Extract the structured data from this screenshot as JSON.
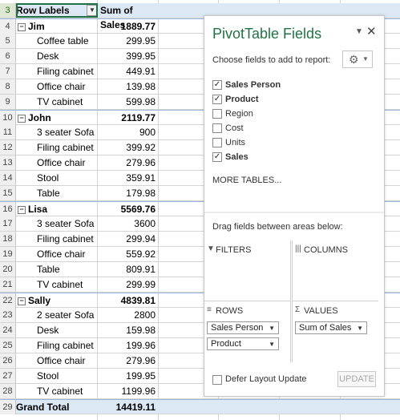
{
  "pivot": {
    "header_row_num": "3",
    "col_a_header": "Row Labels",
    "col_b_header": "Sum of Sales",
    "rows": [
      {
        "num": "4",
        "label": "Jim",
        "value": "1889.77",
        "kind": "group"
      },
      {
        "num": "5",
        "label": "Coffee table",
        "value": "299.95",
        "kind": "item"
      },
      {
        "num": "6",
        "label": "Desk",
        "value": "399.95",
        "kind": "item"
      },
      {
        "num": "7",
        "label": "Filing cabinet",
        "value": "449.91",
        "kind": "item"
      },
      {
        "num": "8",
        "label": "Office chair",
        "value": "139.98",
        "kind": "item"
      },
      {
        "num": "9",
        "label": "TV cabinet",
        "value": "599.98",
        "kind": "item"
      },
      {
        "num": "10",
        "label": "John",
        "value": "2119.77",
        "kind": "group"
      },
      {
        "num": "11",
        "label": "3 seater Sofa",
        "value": "900",
        "kind": "item"
      },
      {
        "num": "12",
        "label": "Filing cabinet",
        "value": "399.92",
        "kind": "item"
      },
      {
        "num": "13",
        "label": "Office chair",
        "value": "279.96",
        "kind": "item"
      },
      {
        "num": "14",
        "label": "Stool",
        "value": "359.91",
        "kind": "item"
      },
      {
        "num": "15",
        "label": "Table",
        "value": "179.98",
        "kind": "item"
      },
      {
        "num": "16",
        "label": "Lisa",
        "value": "5569.76",
        "kind": "group"
      },
      {
        "num": "17",
        "label": "3 seater Sofa",
        "value": "3600",
        "kind": "item"
      },
      {
        "num": "18",
        "label": "Filing cabinet",
        "value": "299.94",
        "kind": "item"
      },
      {
        "num": "19",
        "label": "Office chair",
        "value": "559.92",
        "kind": "item"
      },
      {
        "num": "20",
        "label": "Table",
        "value": "809.91",
        "kind": "item"
      },
      {
        "num": "21",
        "label": "TV cabinet",
        "value": "299.99",
        "kind": "item"
      },
      {
        "num": "22",
        "label": "Sally",
        "value": "4839.81",
        "kind": "group"
      },
      {
        "num": "23",
        "label": "2 seater Sofa",
        "value": "2800",
        "kind": "item"
      },
      {
        "num": "24",
        "label": "Desk",
        "value": "159.98",
        "kind": "item"
      },
      {
        "num": "25",
        "label": "Filing cabinet",
        "value": "199.96",
        "kind": "item"
      },
      {
        "num": "26",
        "label": "Office chair",
        "value": "279.96",
        "kind": "item"
      },
      {
        "num": "27",
        "label": "Stool",
        "value": "199.95",
        "kind": "item"
      },
      {
        "num": "28",
        "label": "TV cabinet",
        "value": "1199.96",
        "kind": "item"
      },
      {
        "num": "29",
        "label": "Grand Total",
        "value": "14419.11",
        "kind": "total"
      }
    ],
    "collapse_glyph": "⊟",
    "filter_glyph": "▼"
  },
  "pane": {
    "title": "PivotTable Fields",
    "menu_glyph": "▼",
    "close_glyph": "✕",
    "choose_label": "Choose fields to add to report:",
    "gear_glyph": "⚙",
    "gear_dropdown_glyph": "▼",
    "fields": [
      {
        "label": "Sales Person",
        "checked": true
      },
      {
        "label": "Product",
        "checked": true
      },
      {
        "label": "Region",
        "checked": false
      },
      {
        "label": "Cost",
        "checked": false
      },
      {
        "label": "Units",
        "checked": false
      },
      {
        "label": "Sales",
        "checked": true
      }
    ],
    "check_glyph": "✓",
    "more_tables": "MORE TABLES...",
    "drag_label": "Drag fields between areas below:",
    "areas": {
      "filters": {
        "title": "FILTERS",
        "icon": "▼",
        "chips": []
      },
      "columns": {
        "title": "COLUMNS",
        "icon": "|||",
        "chips": []
      },
      "rows": {
        "title": "ROWS",
        "icon": "≡",
        "chips": [
          "Sales Person",
          "Product"
        ]
      },
      "values": {
        "title": "VALUES",
        "icon": "Σ",
        "chips": [
          "Sum of Sales"
        ]
      }
    },
    "chip_arrow": "▼",
    "defer_label": "Defer Layout Update",
    "update_label": "UPDATE"
  },
  "colors": {
    "accent_green": "#217346",
    "pivot_header_bg": "#dde8f5"
  }
}
